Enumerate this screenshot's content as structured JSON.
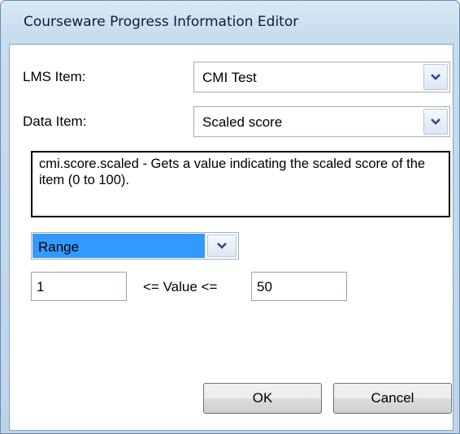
{
  "window": {
    "title": "Courseware Progress Information Editor"
  },
  "lms_item": {
    "label": "LMS Item:",
    "value": "CMI Test"
  },
  "data_item": {
    "label": "Data Item:",
    "value": "Scaled score"
  },
  "description": "cmi.score.scaled - Gets a value indicating the scaled score of the item (0 to 100).",
  "condition": {
    "value": "Range",
    "selected_color": "#3399ff"
  },
  "range": {
    "min": "1",
    "operator_text": "<= Value <=",
    "max": "50"
  },
  "buttons": {
    "ok": "OK",
    "cancel": "Cancel"
  },
  "icons": {
    "dropdown": "chevron-down-icon"
  }
}
